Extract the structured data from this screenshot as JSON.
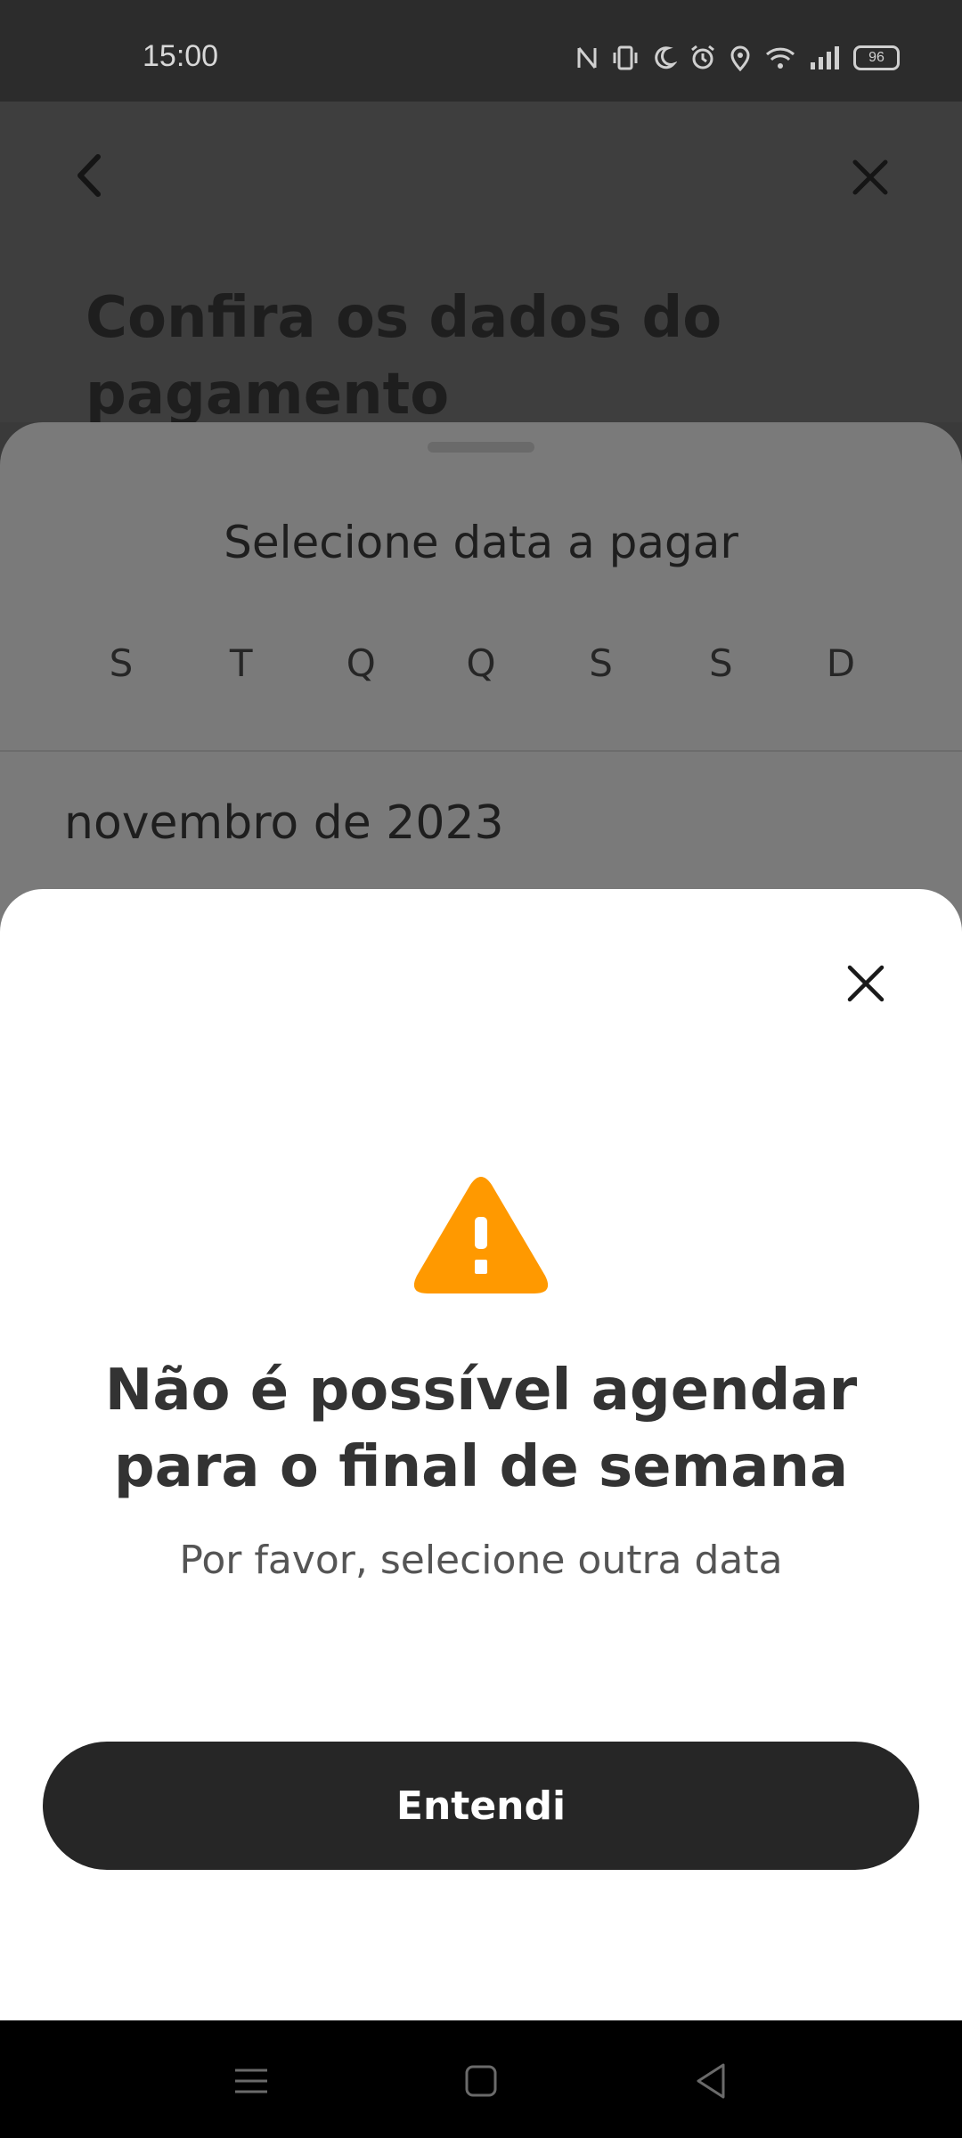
{
  "status_bar": {
    "time": "15:00",
    "battery": "96",
    "icons": [
      "nfc-icon",
      "vibrate-icon",
      "moon-icon",
      "alarm-icon",
      "location-icon",
      "wifi-icon",
      "signal-icon",
      "battery-icon"
    ]
  },
  "page": {
    "title": "Confira os dados do pagamento",
    "back_icon": "chevron-left-icon",
    "close_icon": "close-icon"
  },
  "date_sheet": {
    "title": "Selecione data a pagar",
    "weekdays": [
      "S",
      "T",
      "Q",
      "Q",
      "S",
      "S",
      "D"
    ],
    "month": "novembro de 2023"
  },
  "dialog": {
    "icon": "warning-icon",
    "icon_color": "#FF9900",
    "title": "Não é possível agendar para o final de semana",
    "subtitle": "Por favor, selecione outra data",
    "button_label": "Entendi",
    "close_icon": "close-icon"
  },
  "nav_bar": {
    "icons": [
      "menu-icon",
      "home-icon",
      "back-icon"
    ]
  }
}
